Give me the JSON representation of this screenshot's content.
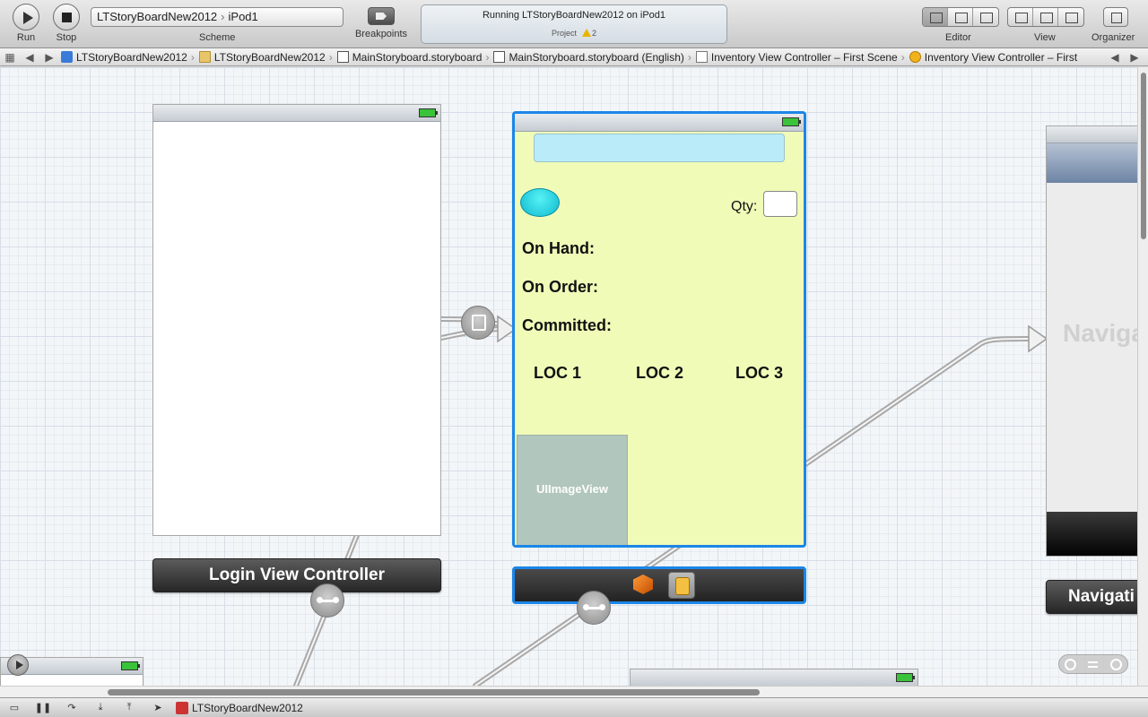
{
  "toolbar": {
    "run_label": "Run",
    "stop_label": "Stop",
    "scheme_label": "Scheme",
    "scheme_project": "LTStoryBoardNew2012",
    "scheme_separator": "›",
    "scheme_device": "iPod1",
    "breakpoints_label": "Breakpoints",
    "activity_title": "Running LTStoryBoardNew2012 on iPod1",
    "activity_project": "Project",
    "activity_warnings": "2",
    "editor_label": "Editor",
    "view_label": "View",
    "organizer_label": "Organizer"
  },
  "jumpbar": {
    "crumbs": [
      "LTStoryBoardNew2012",
      "LTStoryBoardNew2012",
      "MainStoryboard.storyboard",
      "MainStoryboard.storyboard (English)",
      "Inventory View Controller – First Scene",
      "Inventory View Controller – First"
    ]
  },
  "canvas": {
    "login_label": "Login View Controller",
    "inventory": {
      "qty_label": "Qty:",
      "on_hand": "On Hand:",
      "on_order": "On Order:",
      "committed": "Committed:",
      "loc1": "LOC 1",
      "loc2": "LOC 2",
      "loc3": "LOC 3",
      "image_view": "UIImageView"
    },
    "nav_text": "Navigation",
    "nav_label": "Navigati"
  },
  "debugbar": {
    "target": "LTStoryBoardNew2012"
  },
  "colors": {
    "selection": "#1b86e8",
    "scene_background": "#f0fbb8",
    "search_bar": "#b9ecf8"
  }
}
